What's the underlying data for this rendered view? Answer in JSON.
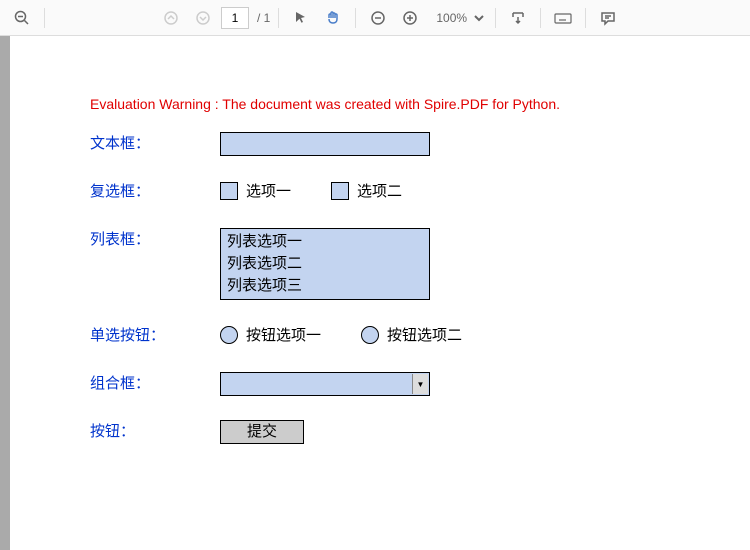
{
  "toolbar": {
    "page_current": "1",
    "page_total": "/ 1",
    "zoom": "100%"
  },
  "warning": "Evaluation Warning : The document was created with Spire.PDF for Python.",
  "form": {
    "textbox_label": "文本框：",
    "checkbox_label": "复选框：",
    "checkbox_opt1": "选项一",
    "checkbox_opt2": "选项二",
    "listbox_label": "列表框：",
    "listbox_items": [
      "列表选项一",
      "列表选项二",
      "列表选项三"
    ],
    "radio_label": "单选按钮：",
    "radio_opt1": "按钮选项一",
    "radio_opt2": "按钮选项二",
    "combo_label": "组合框：",
    "button_label": "按钮：",
    "submit": "提交"
  }
}
